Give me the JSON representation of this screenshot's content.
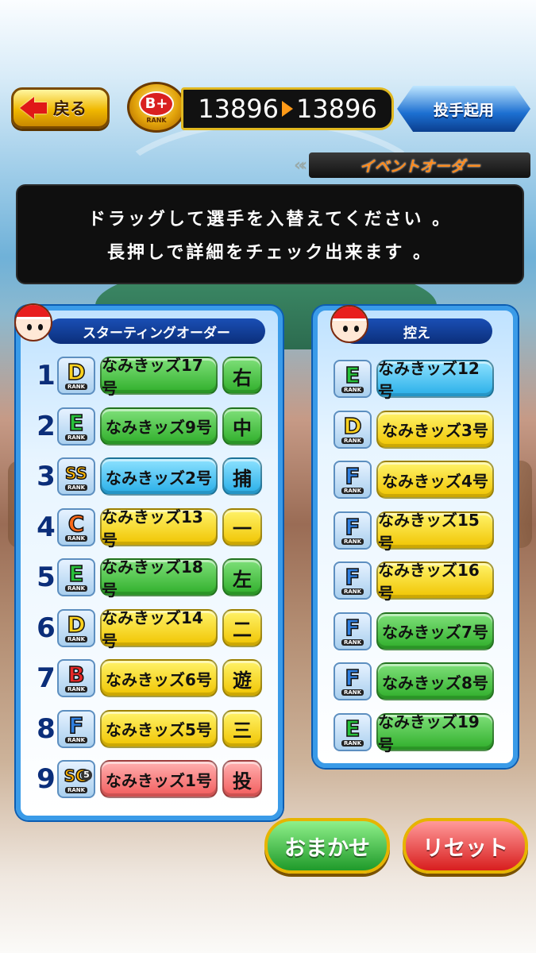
{
  "header": {
    "back_label": "戻る",
    "rank": "B+",
    "rank_sub": "RANK",
    "score_from": "13896",
    "score_to": "13896",
    "pitcher_button": "投手起用",
    "event_banner": "イベントオーダー"
  },
  "instructions": [
    "ドラッグして選手を入替えてください 。",
    "長押しで詳細をチェック出来ます 。"
  ],
  "starting": {
    "title": "スターティングオーダー",
    "players": [
      {
        "order": "1",
        "rank": "D",
        "name": "なみきッズ17号",
        "position": "右",
        "name_color": "green",
        "pos_color": "green"
      },
      {
        "order": "2",
        "rank": "E",
        "name": "なみきッズ9号",
        "position": "中",
        "name_color": "green",
        "pos_color": "green"
      },
      {
        "order": "3",
        "rank": "SS",
        "name": "なみきッズ2号",
        "position": "捕",
        "name_color": "blue",
        "pos_color": "blue"
      },
      {
        "order": "4",
        "rank": "C",
        "name": "なみきッズ13号",
        "position": "一",
        "name_color": "yellow",
        "pos_color": "yellow"
      },
      {
        "order": "5",
        "rank": "E",
        "name": "なみきッズ18号",
        "position": "左",
        "name_color": "green",
        "pos_color": "green"
      },
      {
        "order": "6",
        "rank": "D",
        "name": "なみきッズ14号",
        "position": "二",
        "name_color": "yellow",
        "pos_color": "yellow"
      },
      {
        "order": "7",
        "rank": "B",
        "name": "なみきッズ6号",
        "position": "遊",
        "name_color": "yellow",
        "pos_color": "yellow"
      },
      {
        "order": "8",
        "rank": "F",
        "name": "なみきッズ5号",
        "position": "三",
        "name_color": "yellow",
        "pos_color": "yellow"
      },
      {
        "order": "9",
        "rank": "SG",
        "rank_sup": "5",
        "name": "なみきッズ1号",
        "position": "投",
        "name_color": "red",
        "pos_color": "red"
      }
    ]
  },
  "bench": {
    "title": "控え",
    "players": [
      {
        "rank": "E",
        "name": "なみきッズ12号",
        "name_color": "blue"
      },
      {
        "rank": "D",
        "name": "なみきッズ3号",
        "name_color": "yellow"
      },
      {
        "rank": "F",
        "name": "なみきッズ4号",
        "name_color": "yellow"
      },
      {
        "rank": "F",
        "name": "なみきッズ15号",
        "name_color": "yellow"
      },
      {
        "rank": "F",
        "name": "なみきッズ16号",
        "name_color": "yellow"
      },
      {
        "rank": "F",
        "name": "なみきッズ7号",
        "name_color": "green"
      },
      {
        "rank": "F",
        "name": "なみきッズ8号",
        "name_color": "green"
      },
      {
        "rank": "E",
        "name": "なみきッズ19号",
        "name_color": "green"
      }
    ]
  },
  "rank_label": "RANK",
  "rank_colors": {
    "D": "#ffd21e",
    "E": "#27c23a",
    "SS": "#ffb400",
    "C": "#ff6a1a",
    "B": "#e82828",
    "F": "#2f7fe0",
    "SG": "#ffb400"
  },
  "buttons": {
    "auto": "おまかせ",
    "reset": "リセット",
    "auto_color": "#1f9a2a",
    "reset_color": "#d81e1e"
  }
}
